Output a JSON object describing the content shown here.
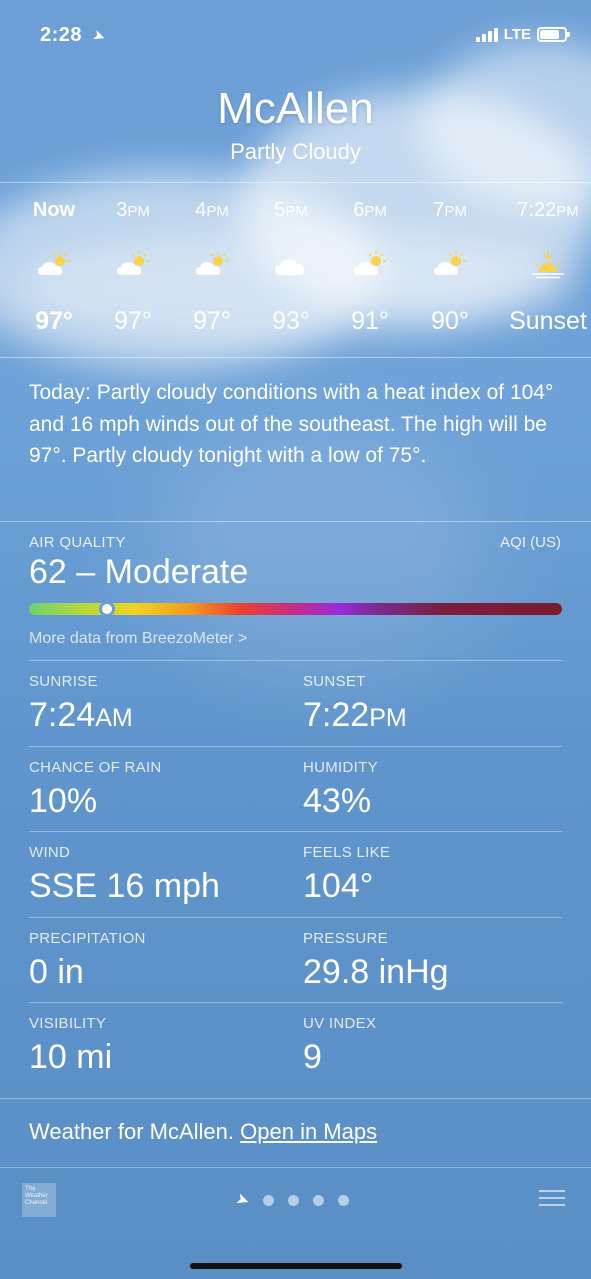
{
  "status_bar": {
    "time": "2:28",
    "location_icon": "location-arrow-icon",
    "network": "LTE"
  },
  "header": {
    "city": "McAllen",
    "condition": "Partly Cloudy"
  },
  "hourly": [
    {
      "time": "Now",
      "suffix": "",
      "icon": "partly-sunny-icon",
      "temp": "97°",
      "bold": true
    },
    {
      "time": "3",
      "suffix": "PM",
      "icon": "partly-sunny-icon",
      "temp": "97°"
    },
    {
      "time": "4",
      "suffix": "PM",
      "icon": "partly-sunny-icon",
      "temp": "97°"
    },
    {
      "time": "5",
      "suffix": "PM",
      "icon": "cloudy-icon",
      "temp": "93°"
    },
    {
      "time": "6",
      "suffix": "PM",
      "icon": "partly-sunny-icon",
      "temp": "91°"
    },
    {
      "time": "7",
      "suffix": "PM",
      "icon": "partly-sunny-icon",
      "temp": "90°"
    },
    {
      "time": "7:22",
      "suffix": "PM",
      "icon": "sunset-icon",
      "temp": "Sunset"
    }
  ],
  "summary": "Today: Partly cloudy conditions with a heat index of 104° and 16 mph winds out of the southeast. The high will be 97°. Partly cloudy tonight with a low of 75°.",
  "air_quality": {
    "label": "AIR QUALITY",
    "unit": "AQI (US)",
    "value": "62 – Moderate",
    "scale_position": 0.146,
    "more_link": "More data from BreezoMeter >"
  },
  "details": [
    {
      "left_label": "SUNRISE",
      "left_value": "7:24",
      "left_unit": "AM",
      "right_label": "SUNSET",
      "right_value": "7:22",
      "right_unit": "PM"
    },
    {
      "left_label": "CHANCE OF RAIN",
      "left_value": "10%",
      "right_label": "HUMIDITY",
      "right_value": "43%"
    },
    {
      "left_label": "WIND",
      "left_value": "SSE 16 mph",
      "right_label": "FEELS LIKE",
      "right_value": "104°"
    },
    {
      "left_label": "PRECIPITATION",
      "left_value": "0 in",
      "right_label": "PRESSURE",
      "right_value": "29.8 inHg"
    },
    {
      "left_label": "VISIBILITY",
      "left_value": "10 mi",
      "right_label": "UV INDEX",
      "right_value": "9"
    }
  ],
  "footer": {
    "text": "Weather for McAllen.",
    "link": "Open in Maps"
  },
  "tabbar": {
    "logo_text": "The Weather Channel",
    "page_count": 4
  }
}
